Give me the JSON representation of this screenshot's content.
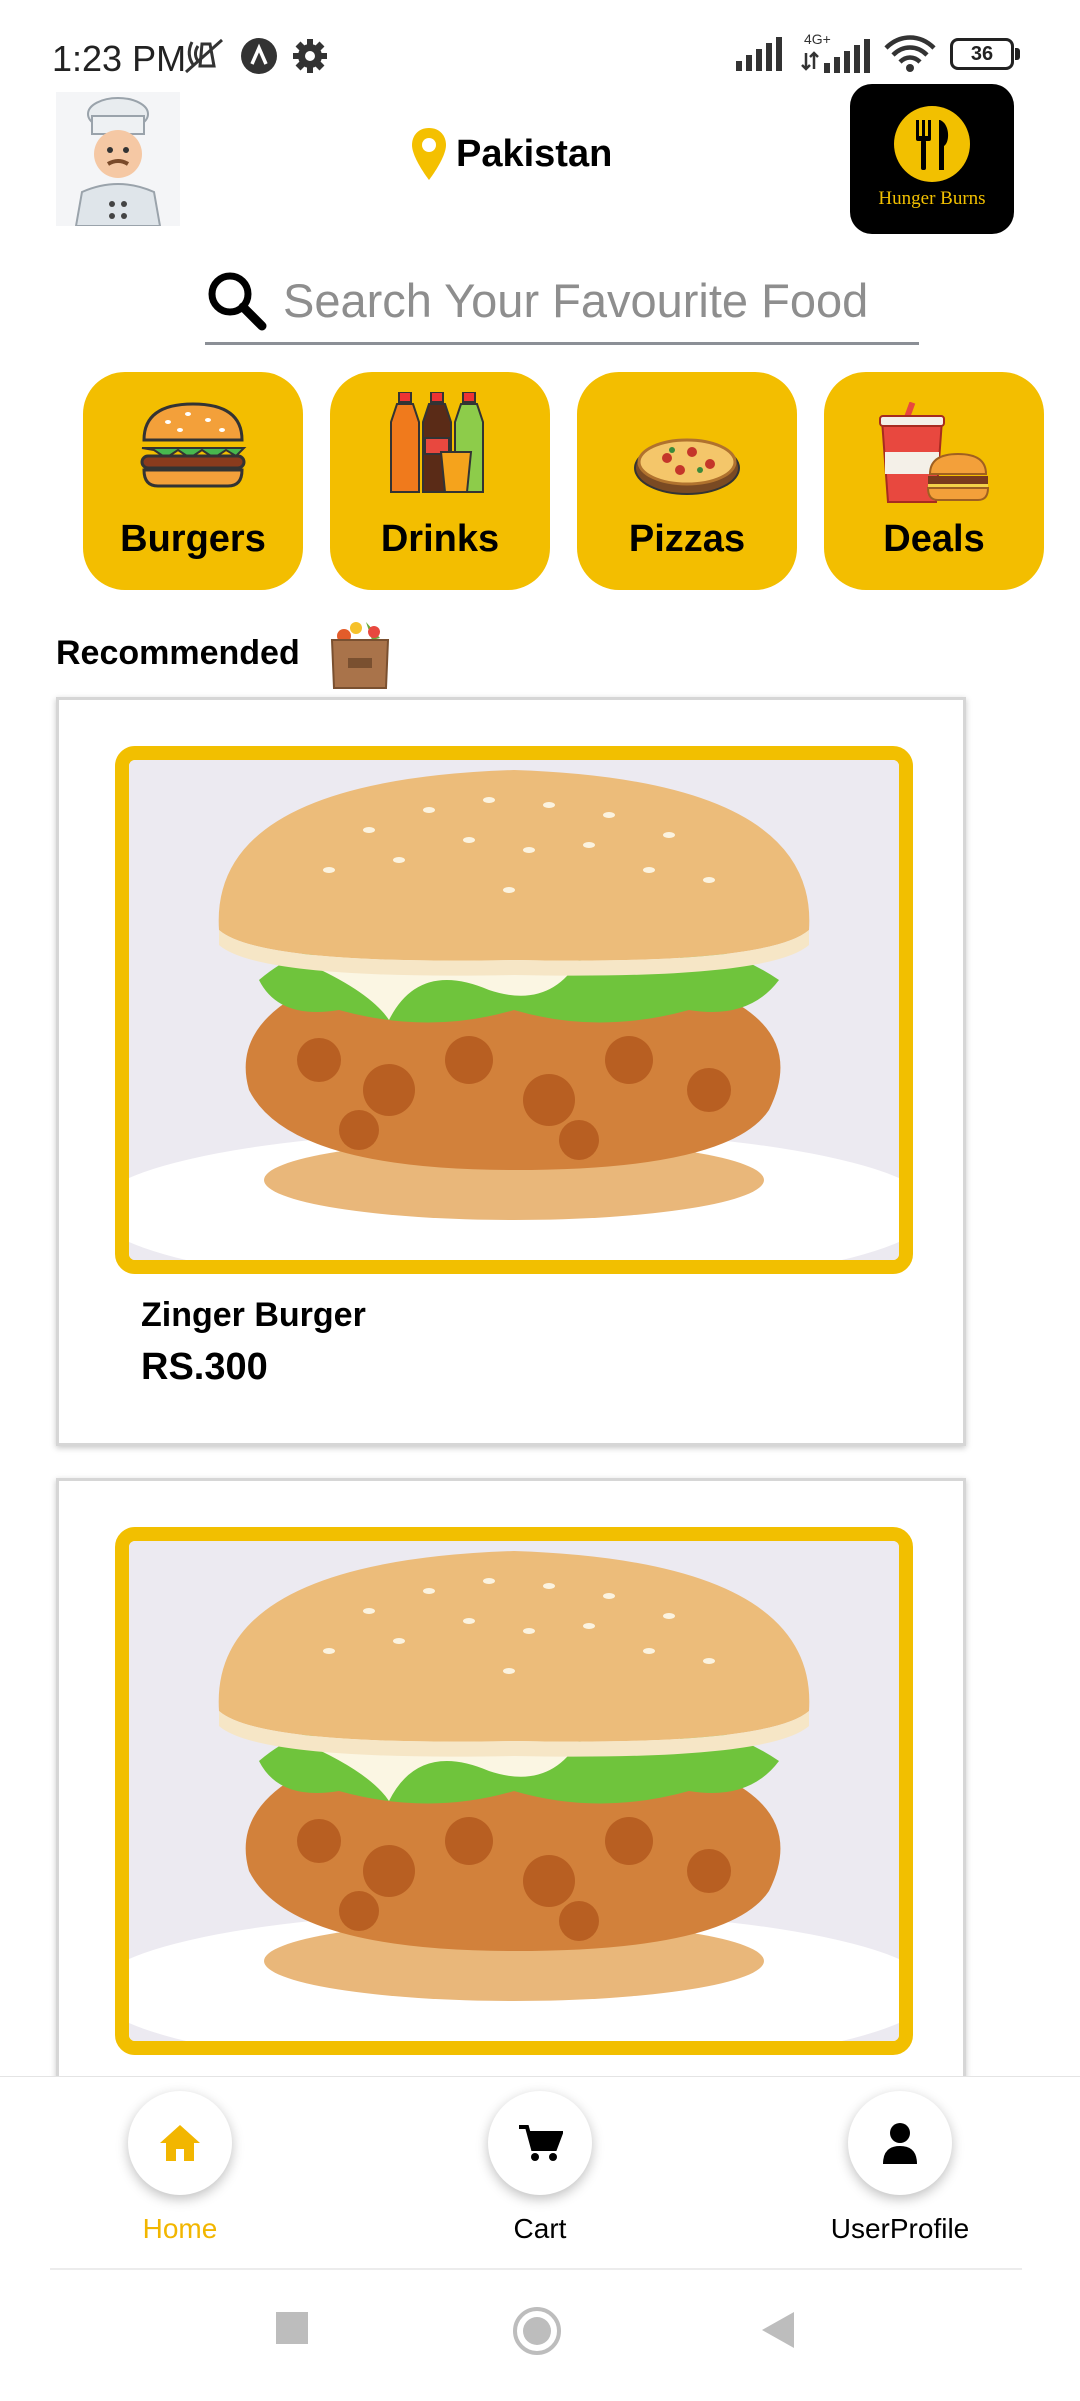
{
  "status_bar": {
    "time": "1:23 PM",
    "network": "4G+",
    "battery": "36"
  },
  "header": {
    "location": "Pakistan",
    "logo_text": "Hunger Burns"
  },
  "search": {
    "placeholder": "Search Your Favourite Food"
  },
  "categories": [
    {
      "label": "Burgers",
      "icon": "burger-icon"
    },
    {
      "label": "Drinks",
      "icon": "drinks-icon"
    },
    {
      "label": "Pizzas",
      "icon": "pizza-icon"
    },
    {
      "label": "Deals",
      "icon": "deals-icon"
    }
  ],
  "recommended": {
    "title": "Recommended",
    "items": [
      {
        "name": "Zinger Burger",
        "price": "RS.300"
      },
      {
        "name": "",
        "price": ""
      }
    ]
  },
  "bottom_nav": {
    "items": [
      {
        "label": "Home",
        "icon": "home-icon",
        "active": true
      },
      {
        "label": "Cart",
        "icon": "cart-icon",
        "active": false
      },
      {
        "label": "UserProfile",
        "icon": "user-icon",
        "active": false
      }
    ]
  },
  "colors": {
    "accent": "#f3be00",
    "active_nav": "#f2b600"
  }
}
